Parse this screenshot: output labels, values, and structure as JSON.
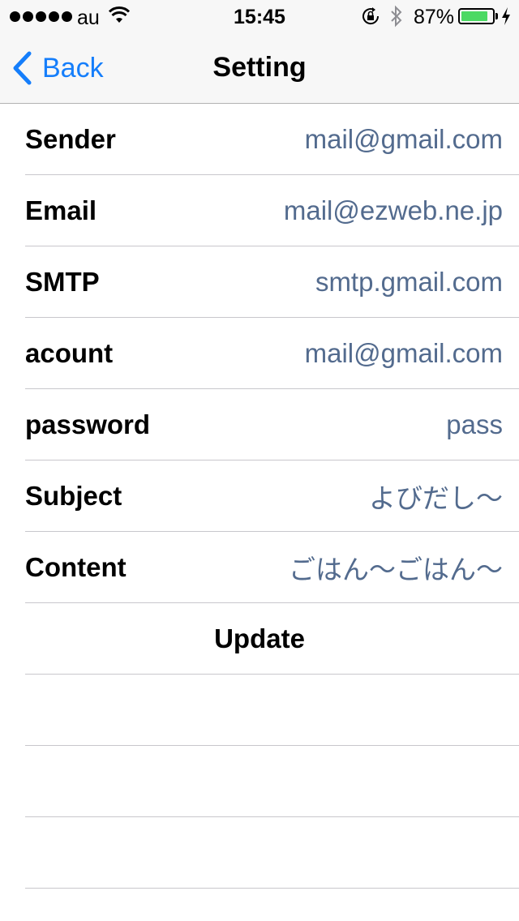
{
  "status_bar": {
    "carrier": "au",
    "time": "15:45",
    "battery_percent": "87%",
    "battery_level": 0.87,
    "battery_color": "#4cd964",
    "icons": [
      "signal-dots-icon",
      "wifi-icon",
      "rotation-lock-icon",
      "bluetooth-icon",
      "battery-icon",
      "charging-bolt-icon"
    ]
  },
  "nav": {
    "back_label": "Back",
    "title": "Setting",
    "accent": "#157efb"
  },
  "settings": [
    {
      "label": "Sender",
      "value": "mail@gmail.com"
    },
    {
      "label": "Email",
      "value": "mail@ezweb.ne.jp"
    },
    {
      "label": "SMTP",
      "value": "smtp.gmail.com"
    },
    {
      "label": "acount",
      "value": "mail@gmail.com"
    },
    {
      "label": "password",
      "value": "pass"
    },
    {
      "label": "Subject",
      "value": "よびだし〜"
    },
    {
      "label": "Content",
      "value": "ごはん〜ごはん〜"
    }
  ],
  "update_label": "Update",
  "value_color": "#536b8e"
}
